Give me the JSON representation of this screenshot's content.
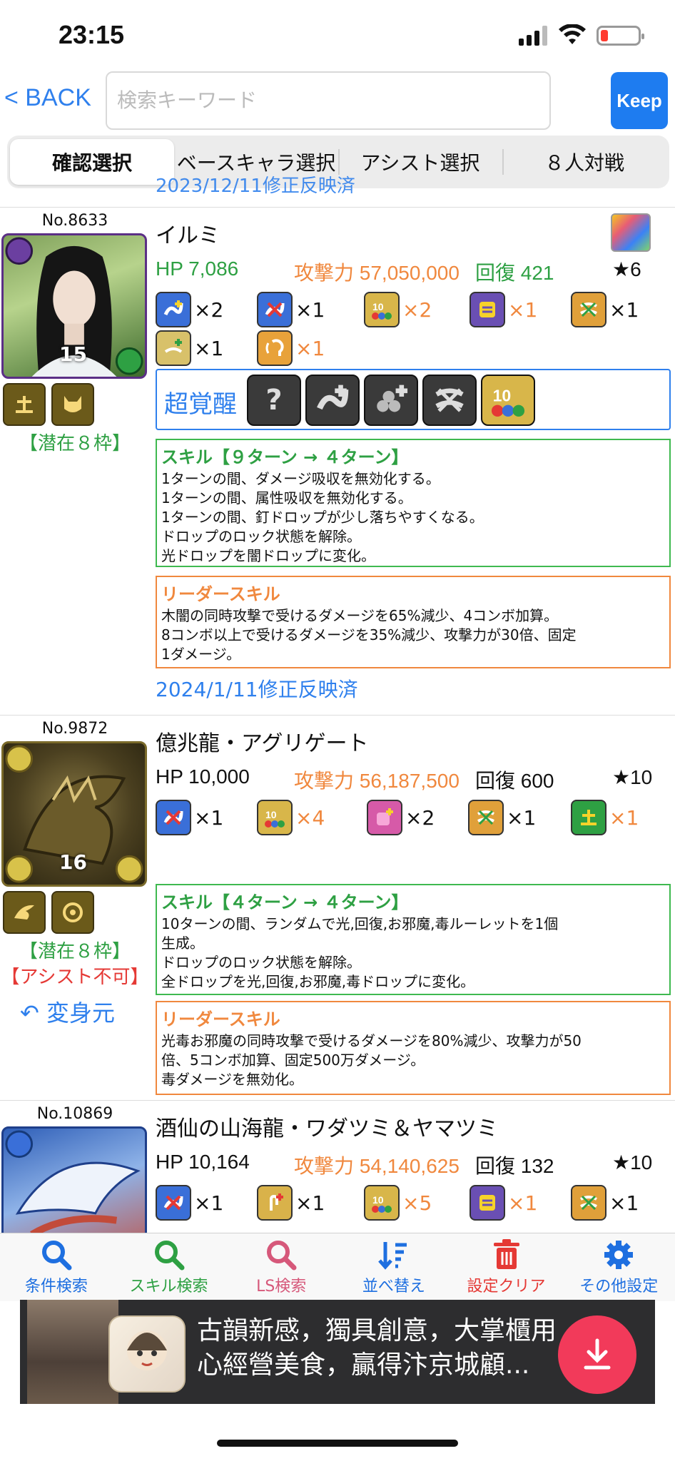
{
  "status": {
    "time": "23:15"
  },
  "nav": {
    "back_label": "< BACK",
    "search_placeholder": "検索キーワード",
    "keep_label": "Keep"
  },
  "tabs": [
    {
      "label": "確認選択",
      "active": true
    },
    {
      "label": "ベースキャラ選択",
      "active": false
    },
    {
      "label": "アシスト選択",
      "active": false
    },
    {
      "label": "８人対戦",
      "active": false
    }
  ],
  "peek_text": "2023/12/11修正反映済",
  "entries": [
    {
      "no": "No.8633",
      "name": "イルミ",
      "hp": "HP 7,086",
      "atk": "攻撃力 57,050,000",
      "rcv": "回復 421",
      "rarity": "★6",
      "level": "15",
      "awakenings": [
        {
          "icon": "skill-boost-plus-icon",
          "count": "×2",
          "color": "black"
        },
        {
          "icon": "skill-bind-resist-icon",
          "count": "×1",
          "color": "black"
        },
        {
          "icon": "ten-combo-plus-icon",
          "count": "×2",
          "color": "orange"
        },
        {
          "icon": "attribute-absorb-icon",
          "count": "×1",
          "color": "orange"
        },
        {
          "icon": "jammer-resist-icon",
          "count": "×1",
          "color": "black"
        },
        {
          "icon": "cloud-resist-icon",
          "count": "×1",
          "color": "black"
        },
        {
          "icon": "voice-awakening-icon",
          "count": "×1",
          "color": "orange"
        }
      ],
      "super_awakening_label": "超覚醒",
      "latent_slots": "【潜在８枠】",
      "skill": {
        "title": "スキル【９ターン → ４ターン】",
        "lines": [
          "1ターンの間、ダメージ吸収を無効化する。",
          "1ターンの間、属性吸収を無効化する。",
          "1ターンの間、釘ドロップが少し落ちやすくなる。",
          "ドロップのロック状態を解除。",
          "光ドロップを闇ドロップに変化。"
        ]
      },
      "leader_skill": {
        "title": "リーダースキル",
        "lines": [
          "木闇の同時攻撃で受けるダメージを65%減少、4コンボ加算。",
          "8コンボ以上で受けるダメージを35%減少、攻撃力が30倍、固定",
          "1ダメージ。"
        ]
      },
      "updated": "2024/1/11修正反映済"
    },
    {
      "no": "No.9872",
      "name": "億兆龍・アグリゲート",
      "hp": "HP 10,000",
      "atk": "攻撃力 56,187,500",
      "rcv": "回復 600",
      "rarity": "★10",
      "level": "16",
      "awakenings": [
        {
          "icon": "skill-bind-resist-icon",
          "count": "×1",
          "color": "black"
        },
        {
          "icon": "ten-combo-plus-icon",
          "count": "×4",
          "color": "orange"
        },
        {
          "icon": "heart-drop-plus-icon",
          "count": "×2",
          "color": "black"
        },
        {
          "icon": "jammer-resist-icon",
          "count": "×1",
          "color": "black"
        },
        {
          "icon": "balance-killer-icon",
          "count": "×1",
          "color": "orange"
        }
      ],
      "latent_slots": "【潜在８枠】",
      "no_assist": "【アシスト不可】",
      "transform_label": "変身元",
      "skill": {
        "title": "スキル【４ターン → ４ターン】",
        "lines": [
          "10ターンの間、ランダムで光,回復,お邪魔,毒ルーレットを1個",
          "生成。",
          "ドロップのロック状態を解除。",
          "全ドロップを光,回復,お邪魔,毒ドロップに変化。"
        ]
      },
      "leader_skill": {
        "title": "リーダースキル",
        "lines": [
          "光毒お邪魔の同時攻撃で受けるダメージを80%減少、攻撃力が50",
          "倍、5コンボ加算、固定500万ダメージ。",
          "毒ダメージを無効化。"
        ]
      }
    },
    {
      "no": "No.10869",
      "name": "酒仙の山海龍・ワダツミ＆ヤマツミ",
      "hp": "HP 10,164",
      "atk": "攻撃力 54,140,625",
      "rcv": "回復 132",
      "rarity": "★10",
      "awakenings": [
        {
          "icon": "skill-bind-resist-icon",
          "count": "×1",
          "color": "black"
        },
        {
          "icon": "finger-extend-icon",
          "count": "×1",
          "color": "black"
        },
        {
          "icon": "ten-combo-plus-icon",
          "count": "×5",
          "color": "orange"
        },
        {
          "icon": "attribute-absorb-icon",
          "count": "×1",
          "color": "orange"
        },
        {
          "icon": "jammer-resist-icon",
          "count": "×1",
          "color": "black"
        }
      ]
    }
  ],
  "toolbar": [
    {
      "label": "条件検索",
      "color": "#1e6fe0",
      "icon": "search-icon"
    },
    {
      "label": "スキル検索",
      "color": "#2ea043",
      "icon": "search-icon"
    },
    {
      "label": "LS検索",
      "color": "#d6587a",
      "icon": "search-icon"
    },
    {
      "label": "並べ替え",
      "color": "#1e6fe0",
      "icon": "sort-icon"
    },
    {
      "label": "設定クリア",
      "color": "#e53935",
      "icon": "trash-icon"
    },
    {
      "label": "その他設定",
      "color": "#1e6fe0",
      "icon": "gear-icon"
    }
  ],
  "ad": {
    "line1": "古韻新感，獨具創意，大掌櫃用",
    "line2": "心經營美食，贏得汴京城顧..."
  },
  "colors": {
    "accent": "#2f80ed",
    "green": "#2ea043",
    "orange": "#f0883e",
    "red": "#e53935"
  }
}
